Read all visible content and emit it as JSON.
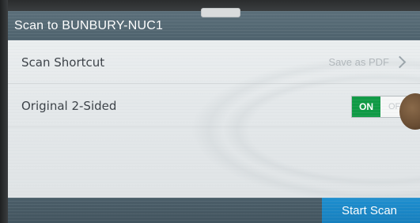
{
  "header": {
    "title": "Scan to BUNBURY-NUC1"
  },
  "settings": {
    "scan_shortcut": {
      "label": "Scan Shortcut",
      "value": "Save as PDF"
    },
    "original_2_sided": {
      "label": "Original 2-Sided",
      "on_label": "ON",
      "off_label": "OFF",
      "state": "on"
    }
  },
  "footer": {
    "start_label": "Start Scan"
  },
  "colors": {
    "title_bar": "#4e626d",
    "toggle_on": "#0f9a45",
    "start_button": "#1d8fd0"
  },
  "icons": {
    "shortcut_arrow": "chevron-right-icon"
  }
}
